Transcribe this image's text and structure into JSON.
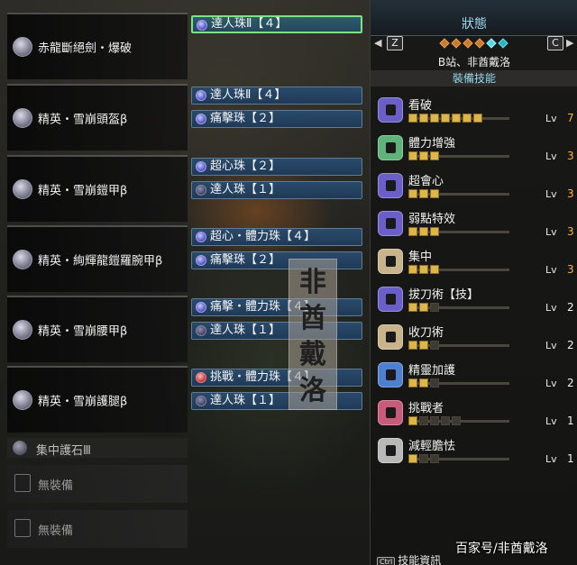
{
  "equipment": [
    {
      "name": "赤龍斷絕劍・爆破"
    },
    {
      "name": "精英・雪崩頭盔β"
    },
    {
      "name": "精英・雪崩鎧甲β"
    },
    {
      "name": "精英・絢輝龍鎧羅腕甲β"
    },
    {
      "name": "精英・雪崩腰甲β"
    },
    {
      "name": "精英・雪崩護腿β"
    }
  ],
  "slots": [
    {
      "label": "達人珠Ⅱ【４】"
    },
    {
      "label": "達人珠Ⅱ【４】"
    },
    {
      "label": "痛擊珠【２】"
    },
    {
      "label": "超心珠【２】"
    },
    {
      "label": "達人珠【１】"
    },
    {
      "label": "超心・體力珠【４】"
    },
    {
      "label": "痛擊珠【２】"
    },
    {
      "label": "痛擊・體力珠【４】"
    },
    {
      "label": "達人珠【１】"
    },
    {
      "label": "挑戰・體力珠【４】"
    },
    {
      "label": "達人珠【１】"
    }
  ],
  "charm": {
    "label": "集中護石Ⅲ"
  },
  "empty": [
    {
      "label": "無裝備"
    },
    {
      "label": "無裝備"
    }
  ],
  "watermark_vertical": [
    "非",
    "酋",
    "戴",
    "洛"
  ],
  "status": {
    "title": "狀態",
    "left_key": "Z",
    "right_key": "C",
    "left_arrow": "◀",
    "right_arrow": "▶",
    "subtitle": "B站、非酋戴洛",
    "section": "裝備技能",
    "lv_label": "Lv"
  },
  "skills": [
    {
      "name": "看破",
      "level": 7,
      "max": 7,
      "color": "#6a5fc8"
    },
    {
      "name": "體力增強",
      "level": 3,
      "max": 3,
      "color": "#5fb37a"
    },
    {
      "name": "超會心",
      "level": 3,
      "max": 3,
      "color": "#6a5fc8"
    },
    {
      "name": "弱點特效",
      "level": 3,
      "max": 3,
      "color": "#6a5fc8"
    },
    {
      "name": "集中",
      "level": 3,
      "max": 3,
      "color": "#c8b38a"
    },
    {
      "name": "拔刀術【技】",
      "level": 2,
      "max": 3,
      "color": "#6a5fc8"
    },
    {
      "name": "收刀術",
      "level": 2,
      "max": 3,
      "color": "#c8b38a"
    },
    {
      "name": "精靈加護",
      "level": 2,
      "max": 3,
      "color": "#4f7fd0"
    },
    {
      "name": "挑戰者",
      "level": 1,
      "max": 5,
      "color": "#c85a7a"
    },
    {
      "name": "減輕膽怯",
      "level": 1,
      "max": 3,
      "color": "#b8b8b8"
    }
  ],
  "footer": {
    "ctrl": "Ctrl",
    "label": "技能資訊"
  },
  "watermark_bottom": "百家号/非酋戴洛"
}
